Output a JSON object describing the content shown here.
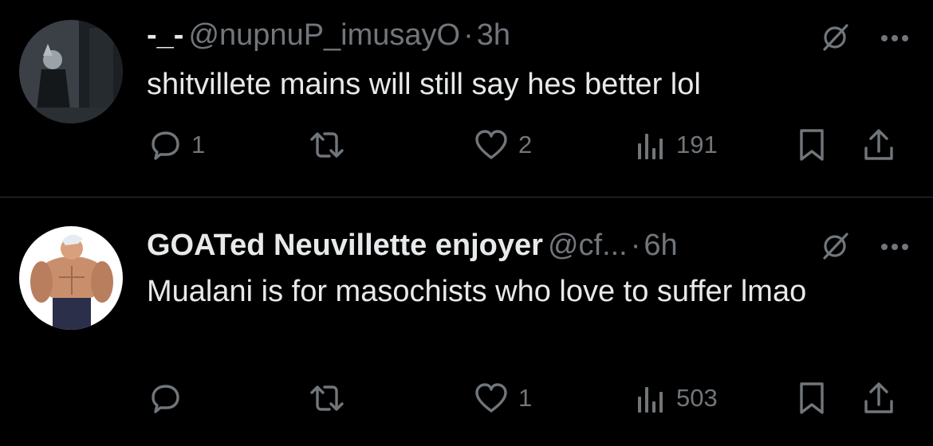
{
  "tweets": [
    {
      "display_name": "-_-",
      "handle": "@nupnuP_imusayO",
      "separator": "·",
      "time": "3h",
      "text": "shitvillete mains will still say hes better lol",
      "stats": {
        "replies": "1",
        "retweets": "",
        "likes": "2",
        "views": "191"
      }
    },
    {
      "display_name": "GOATed Neuvillette enjoyer",
      "handle": "@cf...",
      "separator": "·",
      "time": "6h",
      "text": "Mualani is for masochists who love to suffer lmao",
      "stats": {
        "replies": "",
        "retweets": "",
        "likes": "1",
        "views": "503"
      }
    }
  ],
  "colors": {
    "background": "#000000",
    "primary_text": "#e7e9ea",
    "secondary_text": "#71767b",
    "divider": "#2f3336"
  },
  "icons": [
    "reply-icon",
    "retweet-icon",
    "like-icon",
    "views-icon",
    "bookmark-icon",
    "share-icon",
    "grok-icon",
    "more-icon"
  ]
}
